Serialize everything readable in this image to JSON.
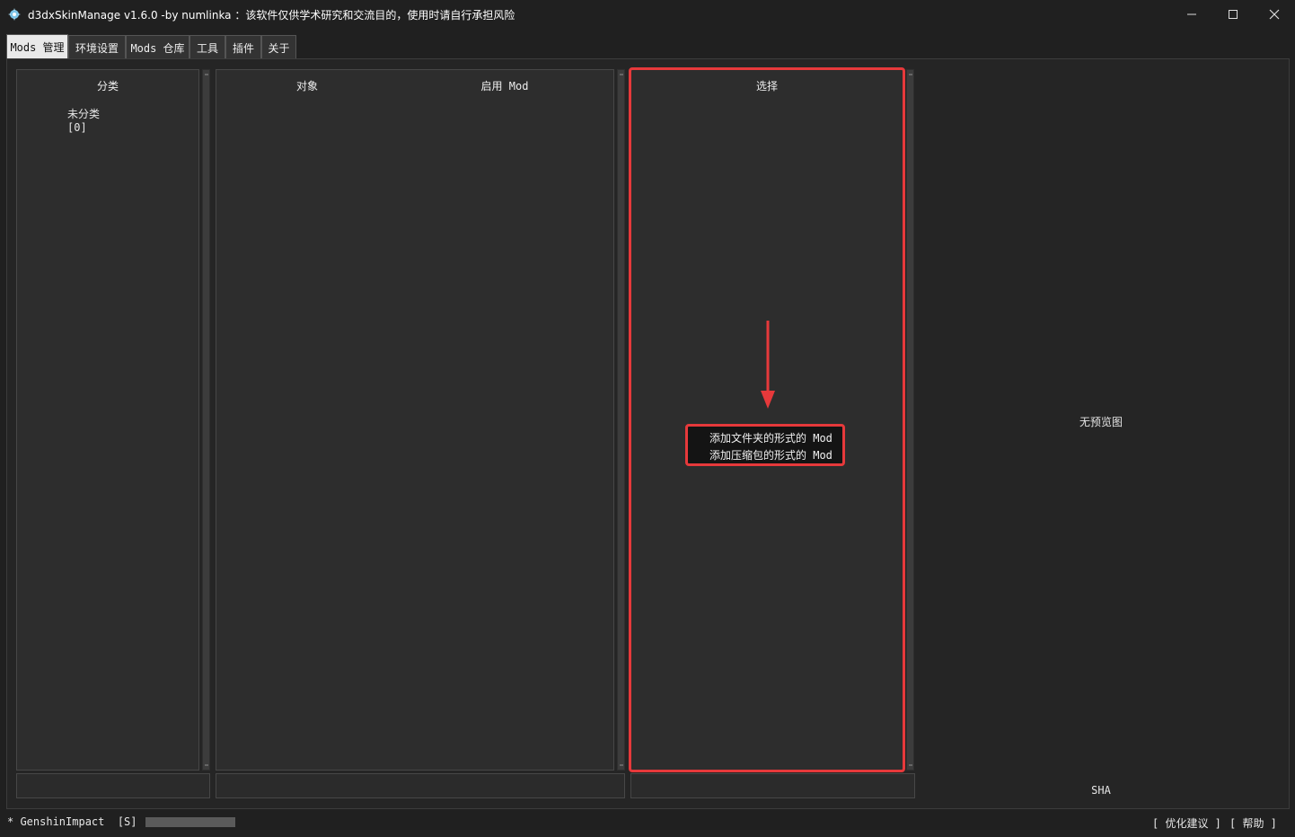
{
  "window": {
    "title": "d3dxSkinManage v1.6.0 -by numlinka ：该软件仅供学术研究和交流目的，使用时请自行承担风险",
    "controls": [
      "minimize",
      "maximize",
      "close"
    ]
  },
  "tabs": [
    {
      "label": "Mods 管理",
      "active": true
    },
    {
      "label": "环境设置",
      "active": false
    },
    {
      "label": "Mods 仓库",
      "active": false
    },
    {
      "label": "工具",
      "active": false
    },
    {
      "label": "插件",
      "active": false
    },
    {
      "label": "关于",
      "active": false
    }
  ],
  "category_panel": {
    "header": "分类",
    "items": [
      {
        "name": "未分类",
        "count": "[0]"
      }
    ]
  },
  "object_panel": {
    "col_object": "对象",
    "col_enabled": "启用 Mod"
  },
  "select_panel": {
    "header": "选择"
  },
  "context_menu": {
    "items": [
      "添加文件夹的形式的 Mod",
      "添加压缩包的形式的 Mod"
    ]
  },
  "preview": {
    "no_preview": "无预览图",
    "sha_label": "SHA"
  },
  "status_bar": {
    "left_text": "* GenshinImpact  [S]  -",
    "links": [
      "[ 优化建议 ]",
      "[ 帮助 ]"
    ]
  },
  "colors": {
    "highlight": "#e6393b",
    "background": "#202020",
    "panel": "#2d2d2d"
  }
}
